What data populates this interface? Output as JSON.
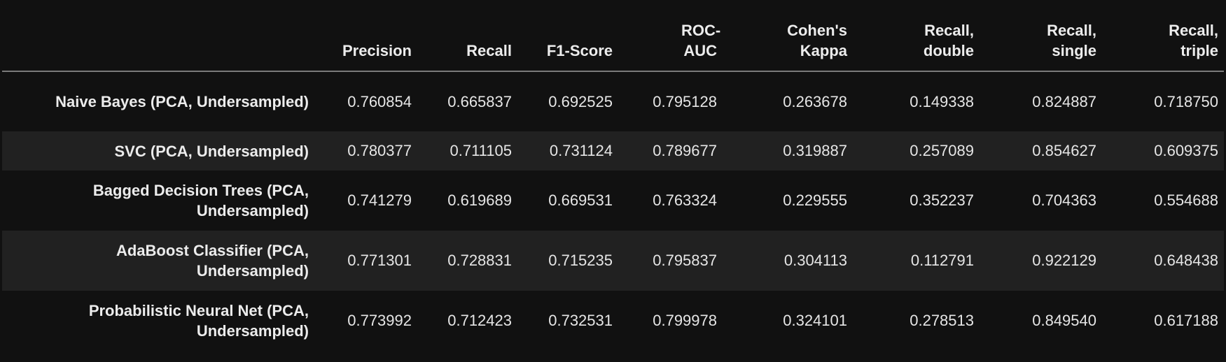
{
  "table": {
    "columns": [
      "Precision",
      "Recall",
      "F1-Score",
      "ROC-AUC",
      "Cohen's Kappa",
      "Recall, double",
      "Recall, single",
      "Recall, triple"
    ],
    "rows": [
      {
        "label": "Naive Bayes (PCA, Undersampled)",
        "values": [
          "0.760854",
          "0.665837",
          "0.692525",
          "0.795128",
          "0.263678",
          "0.149338",
          "0.824887",
          "0.718750"
        ]
      },
      {
        "label": "SVC (PCA, Undersampled)",
        "values": [
          "0.780377",
          "0.711105",
          "0.731124",
          "0.789677",
          "0.319887",
          "0.257089",
          "0.854627",
          "0.609375"
        ]
      },
      {
        "label": "Bagged Decision Trees (PCA, Undersampled)",
        "values": [
          "0.741279",
          "0.619689",
          "0.669531",
          "0.763324",
          "0.229555",
          "0.352237",
          "0.704363",
          "0.554688"
        ]
      },
      {
        "label": "AdaBoost Classifier (PCA, Undersampled)",
        "values": [
          "0.771301",
          "0.728831",
          "0.715235",
          "0.795837",
          "0.304113",
          "0.112791",
          "0.922129",
          "0.648438"
        ]
      },
      {
        "label": "Probabilistic Neural Net (PCA, Undersampled)",
        "values": [
          "0.773992",
          "0.712423",
          "0.732531",
          "0.799978",
          "0.324101",
          "0.278513",
          "0.849540",
          "0.617188"
        ]
      }
    ]
  },
  "colors": {
    "background": "#111111",
    "alt_row": "#212121",
    "text": "#e6e6e6",
    "header_rule": "#7a7a7a"
  }
}
